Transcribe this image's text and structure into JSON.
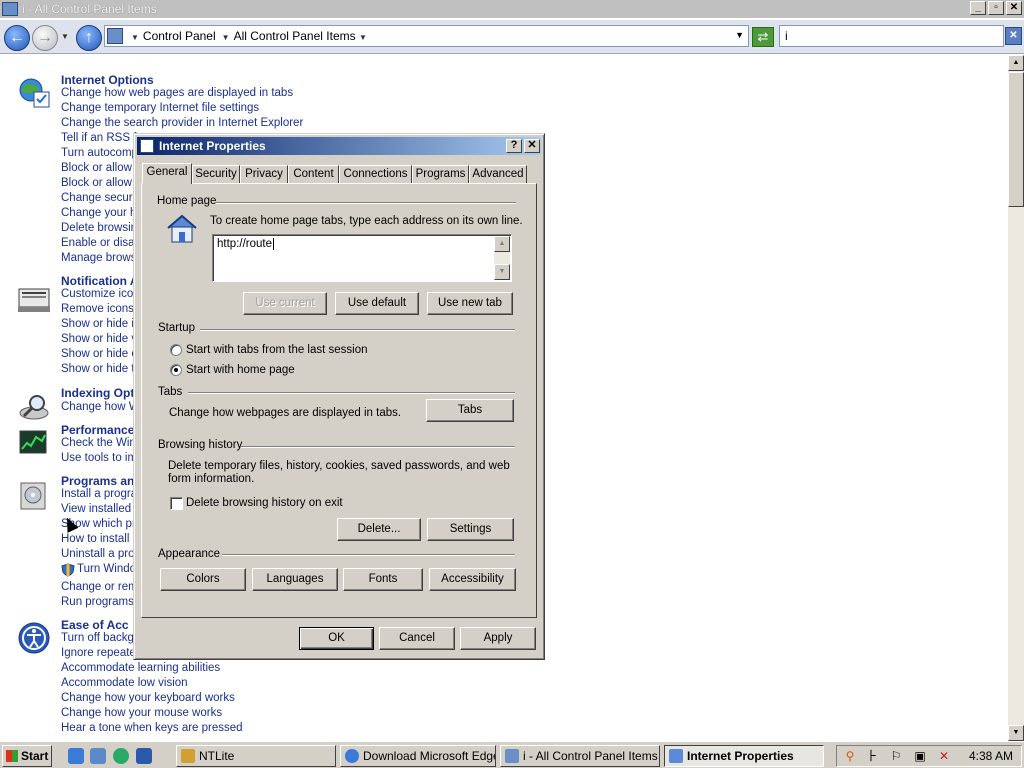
{
  "window": {
    "title": "i - All Control Panel Items"
  },
  "nav": {
    "breadcrumb": [
      "Control Panel",
      "All Control Panel Items"
    ],
    "search_value": "i"
  },
  "groups": [
    {
      "title": "Internet Options",
      "links": [
        "Change how web pages are displayed in tabs",
        "Change temporary Internet file settings",
        "Change the search provider in Internet Explorer",
        "Tell if an RSS f",
        "Turn autocomp",
        "Block or allow p",
        "Block or allow t",
        "Change securit",
        "Change your h",
        "Delete browsin",
        "Enable or disab",
        "Manage brows"
      ]
    },
    {
      "title": "Notification A",
      "links": [
        "Customize icon",
        "Remove icons",
        "Show or hide i",
        "Show or hide v",
        "Show or hide c",
        "Show or hide th"
      ]
    },
    {
      "title": "Indexing Opt",
      "links": [
        "Change how W"
      ]
    },
    {
      "title": "Performance",
      "links": [
        "Check the Win",
        "Use tools to im"
      ]
    },
    {
      "title": "Programs an",
      "links": [
        "Install a progra",
        "View installed u",
        "Show which pr",
        "How to install a",
        "Uninstall a prog",
        "Turn Windo",
        "Change or rem",
        "Run programs m"
      ]
    },
    {
      "title": "Ease of Acc",
      "links": [
        "Turn off backg",
        "Ignore repeate",
        "Accommodate learning abilities",
        "Accommodate low vision",
        "Change how your keyboard works",
        "Change how your mouse works",
        "Hear a tone when keys are pressed"
      ]
    }
  ],
  "dialog": {
    "title": "Internet Properties",
    "tabs": [
      "General",
      "Security",
      "Privacy",
      "Content",
      "Connections",
      "Programs",
      "Advanced"
    ],
    "active_tab": "General",
    "home_page": {
      "section": "Home page",
      "instruction": "To create home page tabs, type each address on its own line.",
      "value": "http://route",
      "btn_current": "Use current",
      "btn_default": "Use default",
      "btn_new_tab": "Use new tab"
    },
    "startup": {
      "section": "Startup",
      "opt_last": "Start with tabs from the last session",
      "opt_home": "Start with home page",
      "selected": "home"
    },
    "tabs_section": {
      "section": "Tabs",
      "text": "Change how webpages are displayed in tabs.",
      "btn": "Tabs"
    },
    "history": {
      "section": "Browsing history",
      "text1": "Delete temporary files, history, cookies, saved passwords, and web",
      "text2": "form information.",
      "chk_label": "Delete browsing history on exit",
      "checked": false,
      "btn_delete": "Delete...",
      "btn_settings": "Settings"
    },
    "appearance": {
      "section": "Appearance",
      "btn_colors": "Colors",
      "btn_languages": "Languages",
      "btn_fonts": "Fonts",
      "btn_accessibility": "Accessibility"
    },
    "footer": {
      "ok": "OK",
      "cancel": "Cancel",
      "apply": "Apply"
    }
  },
  "taskbar": {
    "start": "Start",
    "items": [
      "NTLite",
      "Download Microsoft Edge...",
      "i - All Control Panel Items",
      "Internet Properties"
    ],
    "active": "Internet Properties",
    "clock": "4:38 AM"
  }
}
